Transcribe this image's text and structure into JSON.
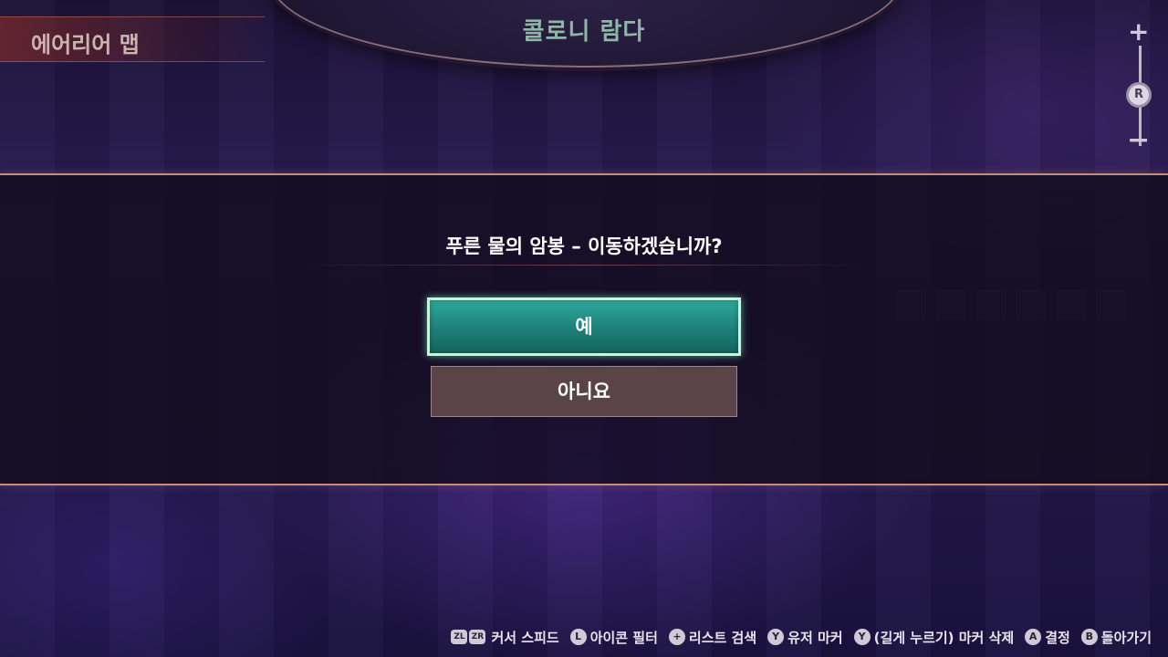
{
  "header": {
    "location_title": "콜로니 람다",
    "area_map_label": "에어리어 맵"
  },
  "zoom": {
    "plus": "+",
    "stick": "R",
    "minus": "−"
  },
  "dialog": {
    "question": "푸른 물의 암봉 – 이동하겠습니까?",
    "yes_label": "예",
    "no_label": "아니요"
  },
  "controls": [
    {
      "keys": [
        "ZL",
        "ZR"
      ],
      "label": "커서 스피드"
    },
    {
      "keys": [
        "L"
      ],
      "label": "아이콘 필터"
    },
    {
      "keys": [
        "+"
      ],
      "label": "리스트 검색"
    },
    {
      "keys": [
        "Y"
      ],
      "label": "유저 마커"
    },
    {
      "keys": [
        "Y"
      ],
      "label": "(길게 누르기) 마커 삭제"
    },
    {
      "keys": [
        "A"
      ],
      "label": "결정"
    },
    {
      "keys": [
        "B"
      ],
      "label": "돌아가기"
    }
  ],
  "colors": {
    "accent_teal": "#1d7f78",
    "border_salmon": "#c98a82",
    "no_button": "#5a4447"
  }
}
